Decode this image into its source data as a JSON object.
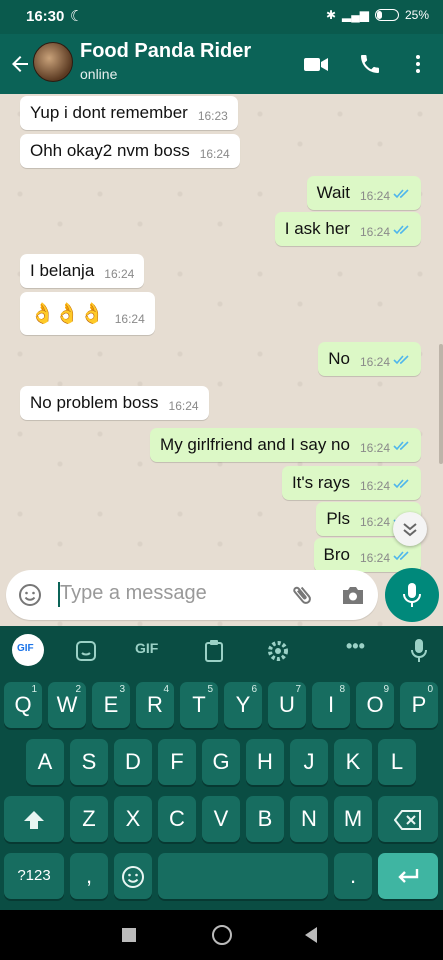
{
  "status": {
    "time": "16:30",
    "battery": "25%"
  },
  "header": {
    "name": "Food Panda Rider",
    "status": "online"
  },
  "messages": [
    {
      "dir": "in",
      "text": "Yup i dont remember",
      "time": "16:23"
    },
    {
      "dir": "in",
      "text": "Ohh okay2 nvm boss",
      "time": "16:24"
    },
    {
      "dir": "out",
      "text": "Wait",
      "time": "16:24"
    },
    {
      "dir": "out",
      "text": "I ask her",
      "time": "16:24"
    },
    {
      "dir": "in",
      "text": "I belanja",
      "time": "16:24"
    },
    {
      "dir": "in",
      "text": "👌👌👌",
      "time": "16:24"
    },
    {
      "dir": "out",
      "text": "No",
      "time": "16:24"
    },
    {
      "dir": "in",
      "text": "No problem boss",
      "time": "16:24"
    },
    {
      "dir": "out",
      "text": "My girlfriend and I say no",
      "time": "16:24"
    },
    {
      "dir": "out",
      "text": "It's rays",
      "time": "16:24"
    },
    {
      "dir": "out",
      "text": "Pls",
      "time": "16:24"
    },
    {
      "dir": "out",
      "text": "Bro",
      "time": "16:24"
    }
  ],
  "input": {
    "placeholder": "Type a message"
  },
  "keyboard": {
    "toolbar": {
      "gif_label": "GIF"
    },
    "row1": [
      {
        "k": "Q",
        "h": "1"
      },
      {
        "k": "W",
        "h": "2"
      },
      {
        "k": "E",
        "h": "3"
      },
      {
        "k": "R",
        "h": "4"
      },
      {
        "k": "T",
        "h": "5"
      },
      {
        "k": "Y",
        "h": "6"
      },
      {
        "k": "U",
        "h": "7"
      },
      {
        "k": "I",
        "h": "8"
      },
      {
        "k": "O",
        "h": "9"
      },
      {
        "k": "P",
        "h": "0"
      }
    ],
    "row2": [
      "A",
      "S",
      "D",
      "F",
      "G",
      "H",
      "J",
      "K",
      "L"
    ],
    "row3": [
      "Z",
      "X",
      "C",
      "V",
      "B",
      "N",
      "M"
    ],
    "symbols": "?123",
    "comma": ",",
    "period": "."
  },
  "colors": {
    "header": "#0b6357",
    "outgoing": "#dcf8c6",
    "incoming": "#ffffff",
    "read_ticks": "#4fb6ec",
    "accent": "#00897b"
  }
}
